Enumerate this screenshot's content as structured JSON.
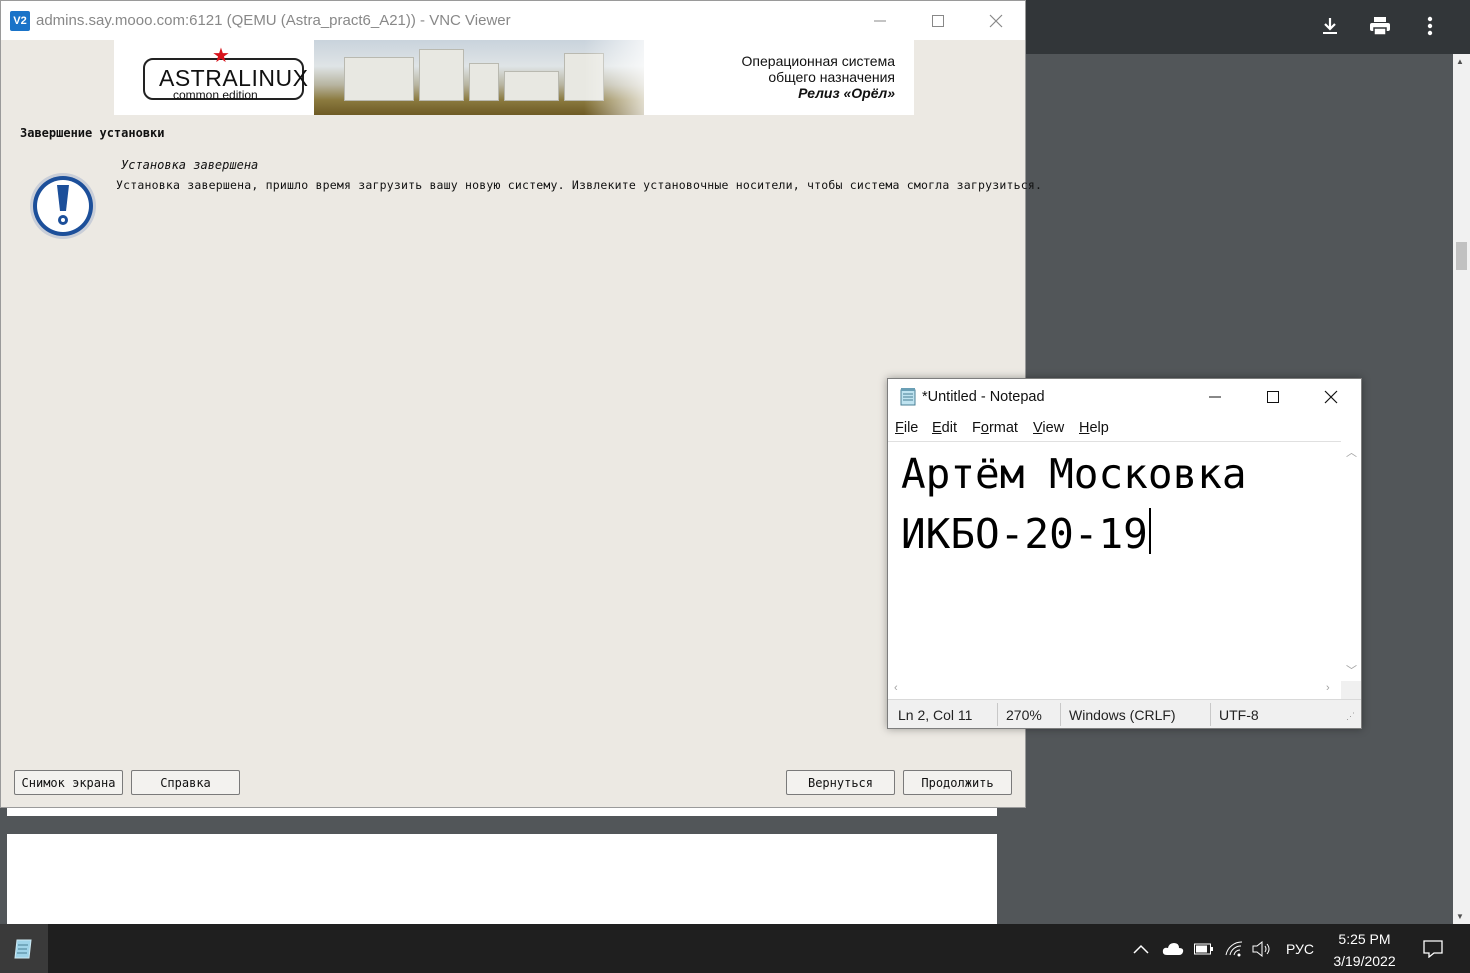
{
  "pdf_viewer": {
    "toolbar_icons": [
      "download-icon",
      "print-icon",
      "more-vertical-icon"
    ]
  },
  "vnc_window": {
    "title": "admins.say.mooo.com:6121 (QEMU (Astra_pract6_A21)) - VNC Viewer",
    "logo_text": "V2"
  },
  "installer": {
    "brand": {
      "name": "ASTRALINUX",
      "edition": "common edition",
      "os_line1": "Операционная система",
      "os_line2": "общего назначения",
      "release": "Релиз «Орёл»"
    },
    "step_title": "Завершение установки",
    "message_heading": "Установка завершена",
    "message_body": "Установка завершена, пришло время загрузить вашу новую систему. Извлеките установочные носители, чтобы система смогла загрузиться.",
    "buttons": {
      "screenshot": "Снимок экрана",
      "help": "Справка",
      "back": "Вернуться",
      "continue": "Продолжить"
    }
  },
  "notepad": {
    "title": "*Untitled - Notepad",
    "menu": {
      "file": {
        "accel": "F",
        "rest": "ile"
      },
      "edit": {
        "accel": "E",
        "rest": "dit"
      },
      "format_pre": "F",
      "format": {
        "accel": "o",
        "rest": "rmat"
      },
      "view": {
        "accel": "V",
        "rest": "iew"
      },
      "help": {
        "accel": "H",
        "rest": "elp"
      }
    },
    "lines": [
      "Артём Московка",
      "ИКБО-20-19"
    ],
    "status": {
      "position": "Ln 2, Col 11",
      "zoom": "270%",
      "line_ending": "Windows (CRLF)",
      "encoding": "UTF-8"
    }
  },
  "taskbar": {
    "language": "РУС",
    "time": "5:25 PM",
    "date": "3/19/2022",
    "tray_icons": [
      "chevron-up-icon",
      "cloud-icon",
      "battery-icon",
      "wifi-icon",
      "volume-icon",
      "notification-icon"
    ]
  }
}
